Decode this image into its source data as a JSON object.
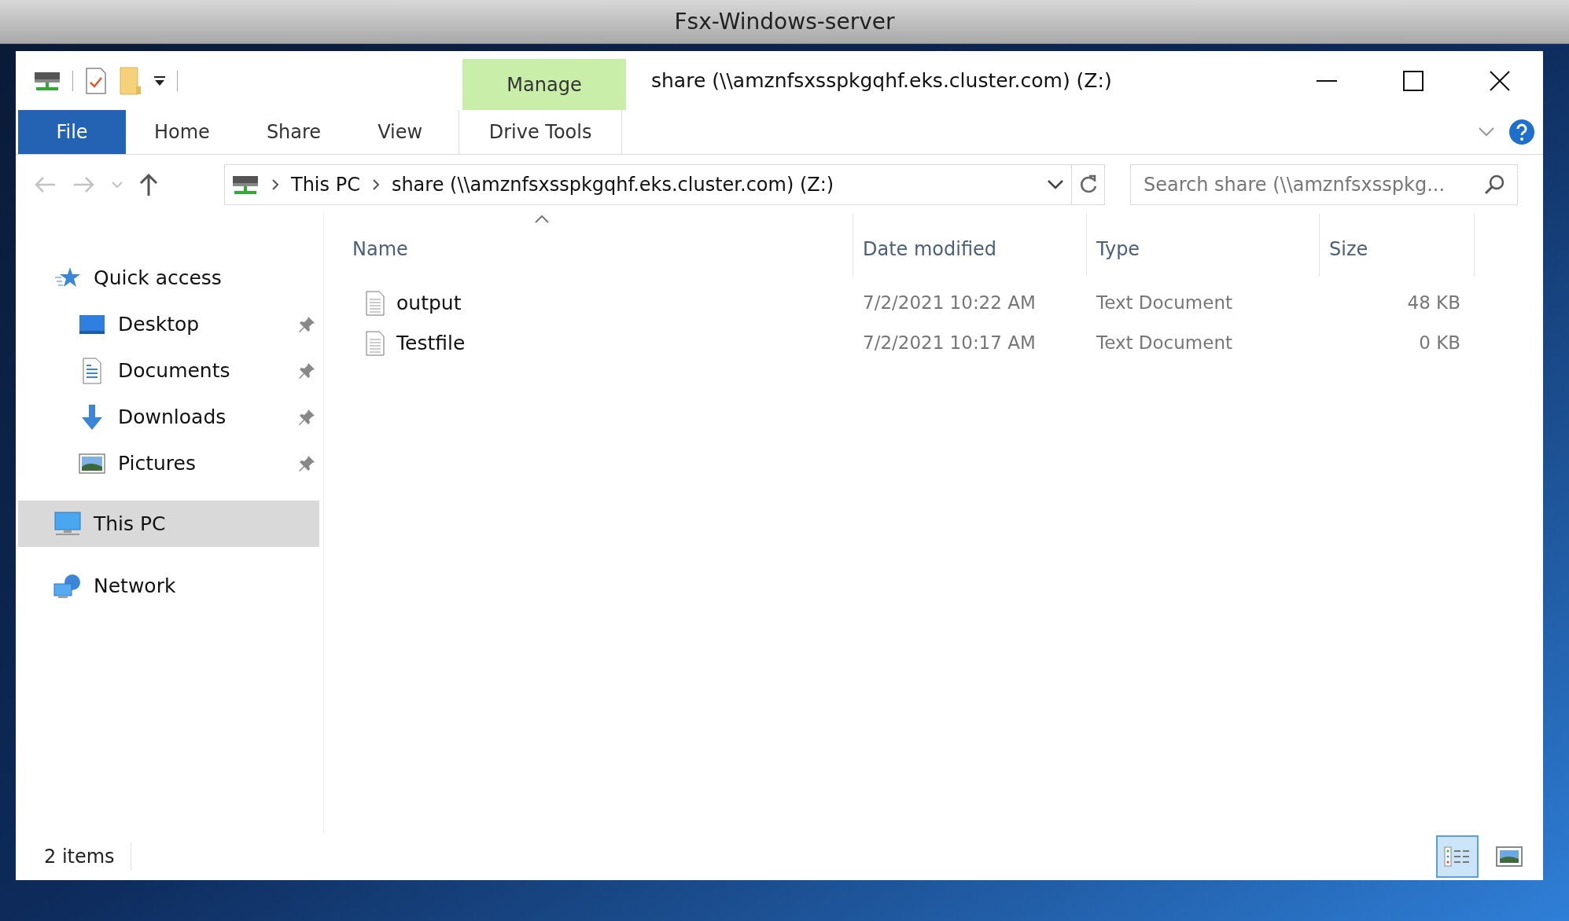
{
  "host_window": {
    "title": "Fsx-Windows-server"
  },
  "explorer": {
    "title": "share (\\\\amznfsxsspkgqhf.eks.cluster.com) (Z:)",
    "contextual_group": "Manage",
    "ribbon_tabs": [
      {
        "label": "File",
        "kind": "file"
      },
      {
        "label": "Home",
        "kind": "normal"
      },
      {
        "label": "Share",
        "kind": "normal"
      },
      {
        "label": "View",
        "kind": "normal"
      },
      {
        "label": "Drive Tools",
        "kind": "contextual"
      }
    ],
    "breadcrumbs": [
      "This PC",
      "share (\\\\amznfsxsspkgqhf.eks.cluster.com) (Z:)"
    ],
    "search": {
      "placeholder": "Search share (\\\\amznfsxsspkg..."
    },
    "sidebar": [
      {
        "label": "Quick access",
        "kind": "star",
        "selected": false,
        "children": [
          {
            "label": "Desktop",
            "kind": "desktop",
            "pinned": true,
            "selected": false
          },
          {
            "label": "Documents",
            "kind": "documents",
            "pinned": true,
            "selected": false
          },
          {
            "label": "Downloads",
            "kind": "downloads",
            "pinned": true,
            "selected": false
          },
          {
            "label": "Pictures",
            "kind": "pictures",
            "pinned": true,
            "selected": false
          }
        ]
      },
      {
        "label": "This PC",
        "kind": "pc",
        "selected": true
      },
      {
        "label": "Network",
        "kind": "network",
        "selected": false
      }
    ],
    "columns": [
      "Name",
      "Date modified",
      "Type",
      "Size"
    ],
    "rows": [
      {
        "name": "output",
        "date": "7/2/2021 10:22 AM",
        "type": "Text Document",
        "size": "48 KB"
      },
      {
        "name": "Testfile",
        "date": "7/2/2021 10:17 AM",
        "type": "Text Document",
        "size": "0 KB"
      }
    ],
    "status": "2 items",
    "views": [
      {
        "kind": "details",
        "selected": true
      },
      {
        "kind": "thumbnails",
        "selected": false
      }
    ]
  }
}
